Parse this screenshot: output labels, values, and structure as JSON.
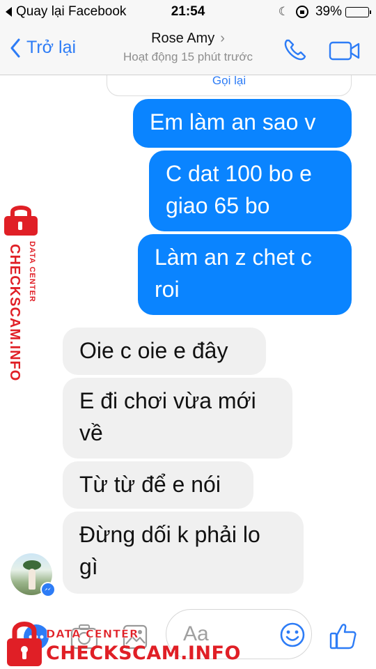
{
  "status_bar": {
    "back_app": "Quay lại Facebook",
    "time": "21:54",
    "battery_percent": "39%",
    "battery_level": 0.39,
    "icons": [
      "moon-icon",
      "rotation-lock-icon",
      "battery-icon"
    ]
  },
  "nav": {
    "back_label": "Trở lại",
    "contact_name": "Rose Amy",
    "chevron": "›",
    "active_status": "Hoạt động 15 phút trước",
    "icons": [
      "back-chevron-icon",
      "phone-icon",
      "video-camera-icon"
    ]
  },
  "chat": {
    "previous_card_text": "Gọi lại",
    "messages": [
      {
        "direction": "outgoing",
        "lines": [
          "Em làm an sao v"
        ]
      },
      {
        "direction": "outgoing",
        "lines": [
          "C dat 100 bo e",
          "giao 65 bo"
        ]
      },
      {
        "direction": "outgoing",
        "lines": [
          "Làm an z chet c",
          "roi"
        ]
      },
      {
        "direction": "incoming",
        "lines": [
          "Oie c oie e đây"
        ]
      },
      {
        "direction": "incoming",
        "lines": [
          "E đi chơi vừa mới",
          "về"
        ]
      },
      {
        "direction": "incoming",
        "lines": [
          "Từ từ để e nói"
        ]
      },
      {
        "direction": "incoming",
        "lines": [
          "Đừng dối k phải lo",
          "gì"
        ]
      }
    ]
  },
  "composer": {
    "placeholder": "Aa",
    "icons": [
      "more-icon",
      "camera-icon",
      "gallery-icon",
      "emoji-icon",
      "thumbs-up-icon"
    ]
  },
  "watermark": {
    "sub": "DATA CENTER",
    "brand": "CHECKSCAM.INFO"
  },
  "colors": {
    "accent": "#2d7cf6",
    "outgoing_bubble": "#0a84ff",
    "incoming_bubble": "#f0f0f0",
    "watermark": "#e01f26"
  }
}
